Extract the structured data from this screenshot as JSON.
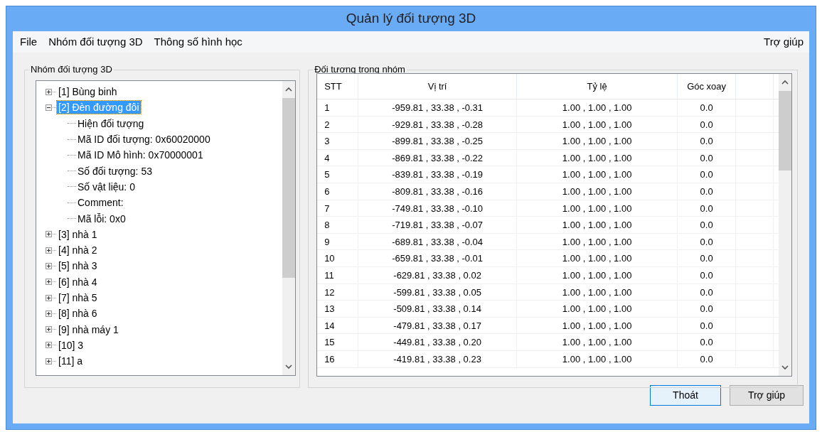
{
  "window": {
    "title": "Quản lý đối tượng 3D"
  },
  "menu": {
    "left": [
      "File",
      "Nhóm đối tượng 3D",
      "Thông số hình học"
    ],
    "right": [
      "Trợ giúp"
    ]
  },
  "tree_group": {
    "title": "Nhóm đối tượng 3D",
    "items": [
      {
        "label": "[1] Bùng binh",
        "expanded": false,
        "selected": false
      },
      {
        "label": "[2] Đèn đường đôi",
        "expanded": true,
        "selected": true,
        "children": [
          {
            "label": "Hiện đối tượng"
          },
          {
            "label": "Mã ID đối tượng: 0x60020000"
          },
          {
            "label": "Mã ID Mô hình: 0x70000001"
          },
          {
            "label": "Số đối tượng: 53"
          },
          {
            "label": "Số vật liệu: 0"
          },
          {
            "label": "Comment:"
          },
          {
            "label": "Mã lỗi: 0x0"
          }
        ]
      },
      {
        "label": "[3] nhà 1",
        "expanded": false,
        "selected": false
      },
      {
        "label": "[4] nhà 2",
        "expanded": false,
        "selected": false
      },
      {
        "label": "[5] nhà 3",
        "expanded": false,
        "selected": false
      },
      {
        "label": "[6] nhà 4",
        "expanded": false,
        "selected": false
      },
      {
        "label": "[7] nhà 5",
        "expanded": false,
        "selected": false
      },
      {
        "label": "[8] nhà 6",
        "expanded": false,
        "selected": false
      },
      {
        "label": "[9] nhà máy 1",
        "expanded": false,
        "selected": false
      },
      {
        "label": "[10] 3",
        "expanded": false,
        "selected": false
      },
      {
        "label": "[11] a",
        "expanded": false,
        "selected": false
      }
    ]
  },
  "table_group": {
    "title": "Đối tượng trong nhóm",
    "columns": [
      "STT",
      "Vị trí",
      "Tỷ lệ",
      "Góc xoay"
    ],
    "rows": [
      [
        "1",
        "-959.81 , 33.38 , -0.31",
        "1.00 , 1.00 , 1.00",
        "0.0"
      ],
      [
        "2",
        "-929.81 , 33.38 , -0.28",
        "1.00 , 1.00 , 1.00",
        "0.0"
      ],
      [
        "3",
        "-899.81 , 33.38 , -0.25",
        "1.00 , 1.00 , 1.00",
        "0.0"
      ],
      [
        "4",
        "-869.81 , 33.38 , -0.22",
        "1.00 , 1.00 , 1.00",
        "0.0"
      ],
      [
        "5",
        "-839.81 , 33.38 , -0.19",
        "1.00 , 1.00 , 1.00",
        "0.0"
      ],
      [
        "6",
        "-809.81 , 33.38 , -0.16",
        "1.00 , 1.00 , 1.00",
        "0.0"
      ],
      [
        "7",
        "-749.81 , 33.38 , -0.10",
        "1.00 , 1.00 , 1.00",
        "0.0"
      ],
      [
        "8",
        "-719.81 , 33.38 , -0.07",
        "1.00 , 1.00 , 1.00",
        "0.0"
      ],
      [
        "9",
        "-689.81 , 33.38 , -0.04",
        "1.00 , 1.00 , 1.00",
        "0.0"
      ],
      [
        "10",
        "-659.81 , 33.38 , -0.01",
        "1.00 , 1.00 , 1.00",
        "0.0"
      ],
      [
        "11",
        "-629.81 , 33.38 , 0.02",
        "1.00 , 1.00 , 1.00",
        "0.0"
      ],
      [
        "12",
        "-599.81 , 33.38 , 0.05",
        "1.00 , 1.00 , 1.00",
        "0.0"
      ],
      [
        "13",
        "-509.81 , 33.38 , 0.14",
        "1.00 , 1.00 , 1.00",
        "0.0"
      ],
      [
        "14",
        "-479.81 , 33.38 , 0.17",
        "1.00 , 1.00 , 1.00",
        "0.0"
      ],
      [
        "15",
        "-449.81 , 33.38 , 0.20",
        "1.00 , 1.00 , 1.00",
        "0.0"
      ],
      [
        "16",
        "-419.81 , 33.38 , 0.23",
        "1.00 , 1.00 , 1.00",
        "0.0"
      ]
    ]
  },
  "buttons": [
    {
      "label": "Thoát",
      "default": true
    },
    {
      "label": "Trợ giúp",
      "default": false
    }
  ]
}
